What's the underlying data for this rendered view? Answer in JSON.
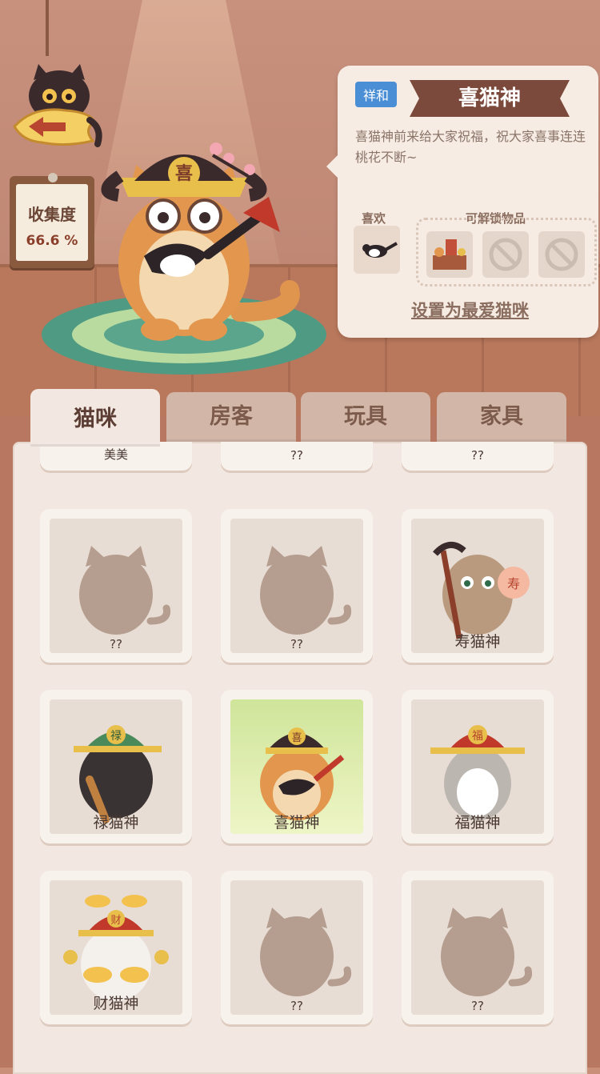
{
  "collection": {
    "label": "收集度",
    "value": "66.6 %"
  },
  "detail": {
    "tag": "祥和",
    "name": "喜猫神",
    "description": "喜猫神前来给大家祝福，祝大家喜事连连桃花不断~",
    "like_label": "喜欢",
    "unlock_label": "可解锁物品",
    "set_favorite": "设置为最爱猫咪"
  },
  "tabs": [
    "猫咪",
    "房客",
    "玩具",
    "家具"
  ],
  "partial_row": [
    "美美",
    "??",
    "??"
  ],
  "cards": [
    {
      "name": "??",
      "type": "silhouette"
    },
    {
      "name": "??",
      "type": "silhouette"
    },
    {
      "name": "寿猫神",
      "type": "shou"
    },
    {
      "name": "禄猫神",
      "type": "lu"
    },
    {
      "name": "喜猫神",
      "type": "xi",
      "selected": true
    },
    {
      "name": "福猫神",
      "type": "fu"
    },
    {
      "name": "财猫神",
      "type": "cai"
    },
    {
      "name": "??",
      "type": "silhouette"
    },
    {
      "name": "??",
      "type": "silhouette"
    }
  ],
  "colors": {
    "accent_tag": "#4a8ed6",
    "ribbon": "#7c4a3c",
    "selected_card": "#cfe59a"
  }
}
